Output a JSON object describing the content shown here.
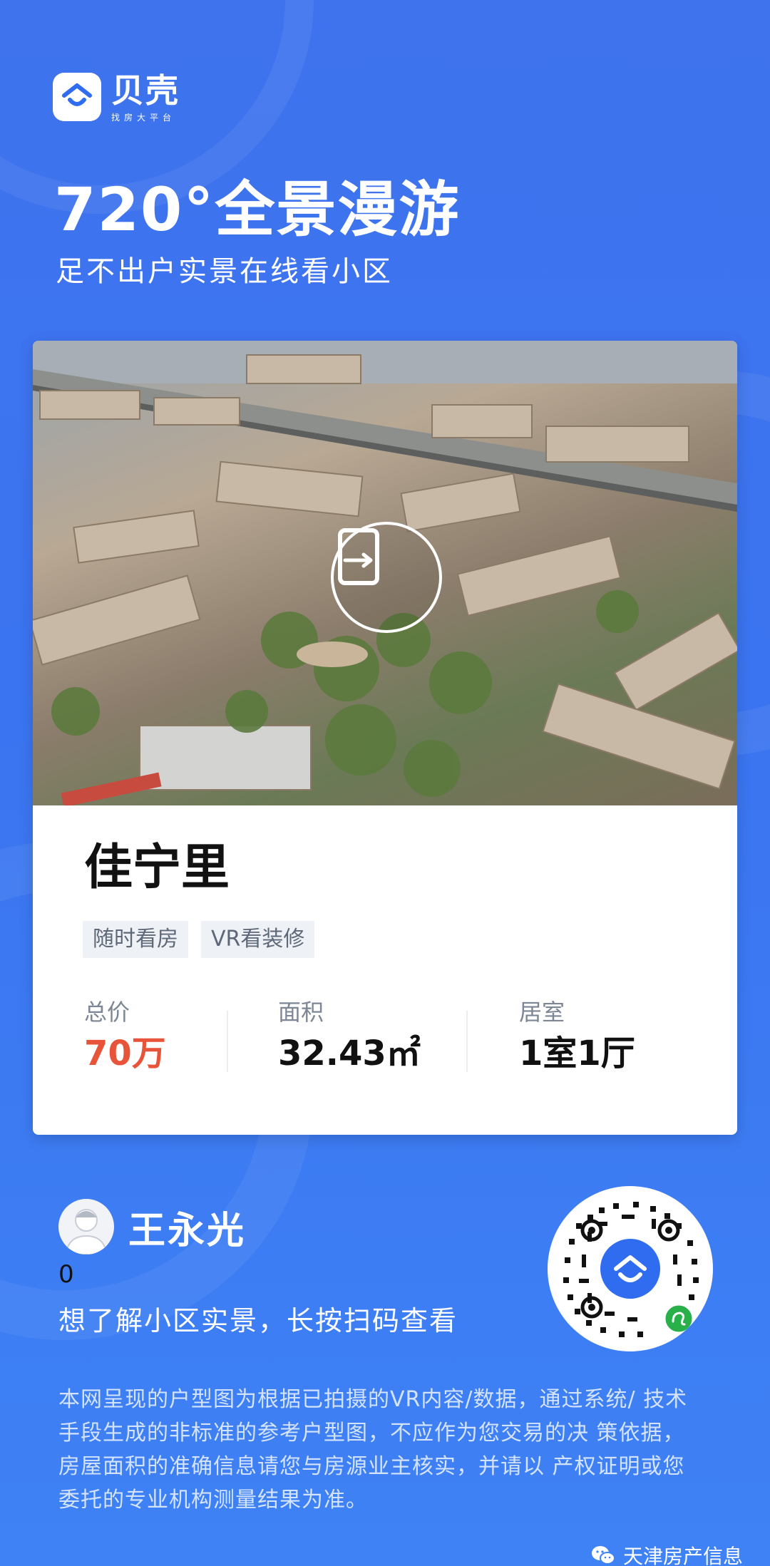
{
  "brand": {
    "name": "贝壳",
    "slogan": "找房大平台"
  },
  "hero": {
    "title": "720°全景漫游",
    "subtitle": "足不出户实景在线看小区"
  },
  "listing": {
    "name": "佳宁里",
    "tags": [
      "随时看房",
      "VR看装修"
    ],
    "stats": [
      {
        "label": "总价",
        "value": "70万"
      },
      {
        "label": "面积",
        "value": "32.43㎡"
      },
      {
        "label": "居室",
        "value": "1室1厅"
      }
    ]
  },
  "agent": {
    "name": "王永光",
    "count": "0",
    "hint": "想了解小区实景，长按扫码查看"
  },
  "disclaimer": [
    "本网呈现的户型图为根据已拍摄的VR内容/数据，通过系统/ 技术",
    "手段生成的非标准的参考户型图，不应作为您交易的决 策依据，",
    "房屋面积的准确信息请您与房源业主核实，并请以 产权证明或您",
    "委托的专业机构测量结果为准。"
  ],
  "watermark": {
    "text": "天津房产信息",
    "icon": "wechat-icon"
  },
  "colors": {
    "background": "#3b74f0",
    "price": "#e8543a",
    "tag_bg": "#eef1f5"
  }
}
